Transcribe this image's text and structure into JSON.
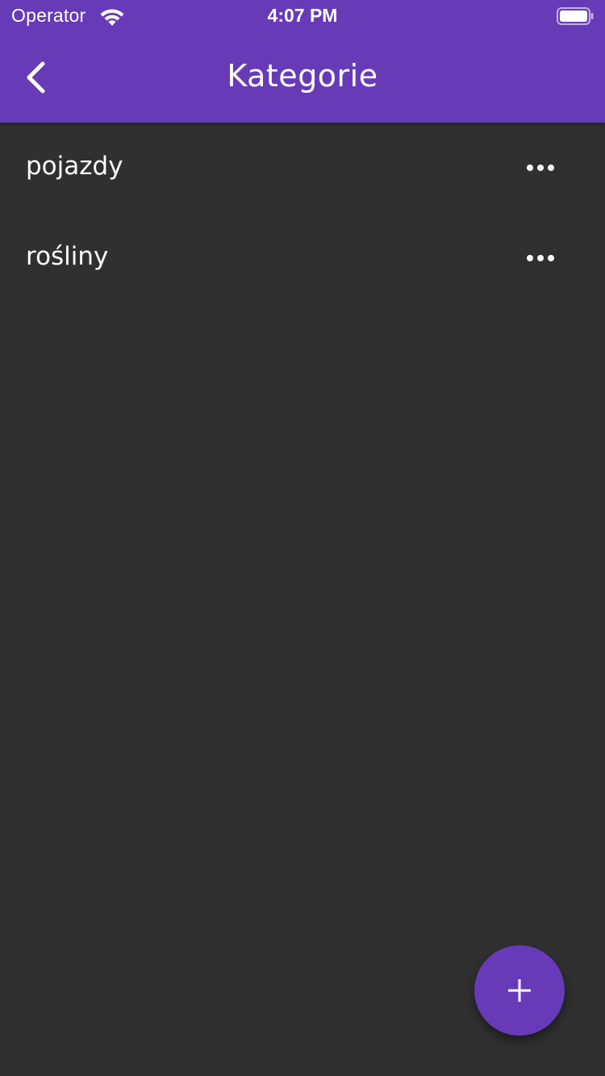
{
  "status_bar": {
    "carrier": "Operator",
    "time": "4:07 PM",
    "wifi_icon": "wifi-icon",
    "battery_icon": "battery-full-icon"
  },
  "appbar": {
    "title": "Kategorie",
    "back_icon": "chevron-left-icon",
    "background_color": "#673ab7"
  },
  "categories": {
    "items": [
      {
        "label": "pojazdy",
        "menu_icon": "more-horizontal-icon"
      },
      {
        "label": "rośliny",
        "menu_icon": "more-horizontal-icon"
      }
    ]
  },
  "fab": {
    "icon": "plus-icon",
    "color": "#673ab7"
  },
  "theme": {
    "background": "#303030",
    "text": "#ffffff"
  }
}
